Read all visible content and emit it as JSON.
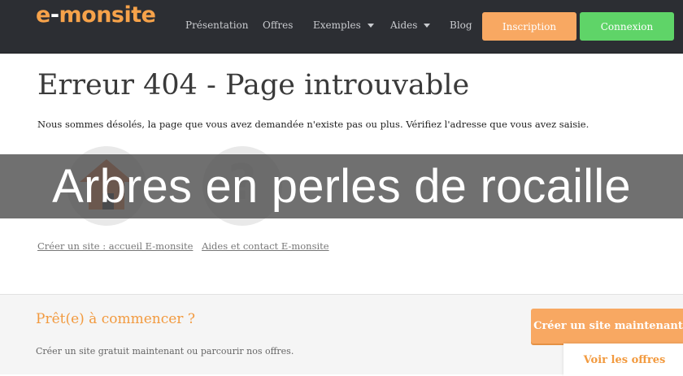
{
  "header": {
    "logo": {
      "e": "e",
      "dash": "-",
      "rest": "monsite"
    },
    "nav": [
      {
        "label": "Présentation",
        "dropdown": false
      },
      {
        "label": "Offres",
        "dropdown": false
      },
      {
        "label": "Exemples",
        "dropdown": true
      },
      {
        "label": "Aides",
        "dropdown": true
      },
      {
        "label": "Blog",
        "dropdown": false
      }
    ],
    "inscription_label": "Inscription",
    "connexion_label": "Connexion"
  },
  "main": {
    "title": "Erreur 404 - Page introuvable",
    "message": "Nous sommes désolés, la page que vous avez demandée n'existe pas ou plus. Vérifiez l'adresse que vous avez saisie.",
    "help_glyph": "?",
    "links": [
      "Créer un site : accueil E-monsite",
      "Aides et contact E-monsite"
    ]
  },
  "overlay": {
    "text": "Arbres en perles de rocaille"
  },
  "footer": {
    "title": "Prêt(e) à commencer ?",
    "subtitle": "Créer un site gratuit maintenant ou parcourir nos offres.",
    "create_label": "Créer un site maintenant",
    "offers_label": "Voir les offres"
  },
  "colors": {
    "header_bg": "#2c2e33",
    "accent_orange": "#f8a862",
    "accent_green": "#5fd468"
  }
}
